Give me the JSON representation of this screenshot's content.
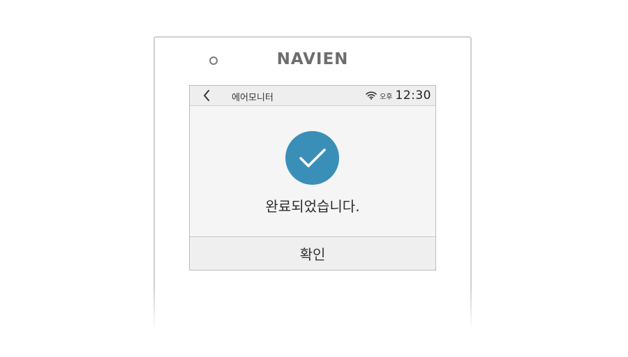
{
  "device": {
    "brand": "NAVIEN"
  },
  "status_bar": {
    "title": "에어모니터",
    "ampm": "오후",
    "time": "12:30",
    "back_icon": "chevron-left-icon",
    "wifi_icon": "wifi-icon"
  },
  "content": {
    "icon": "check-circle-icon",
    "icon_color": "#3a8fb9",
    "message": "완료되었습니다."
  },
  "footer": {
    "confirm_label": "확인"
  }
}
